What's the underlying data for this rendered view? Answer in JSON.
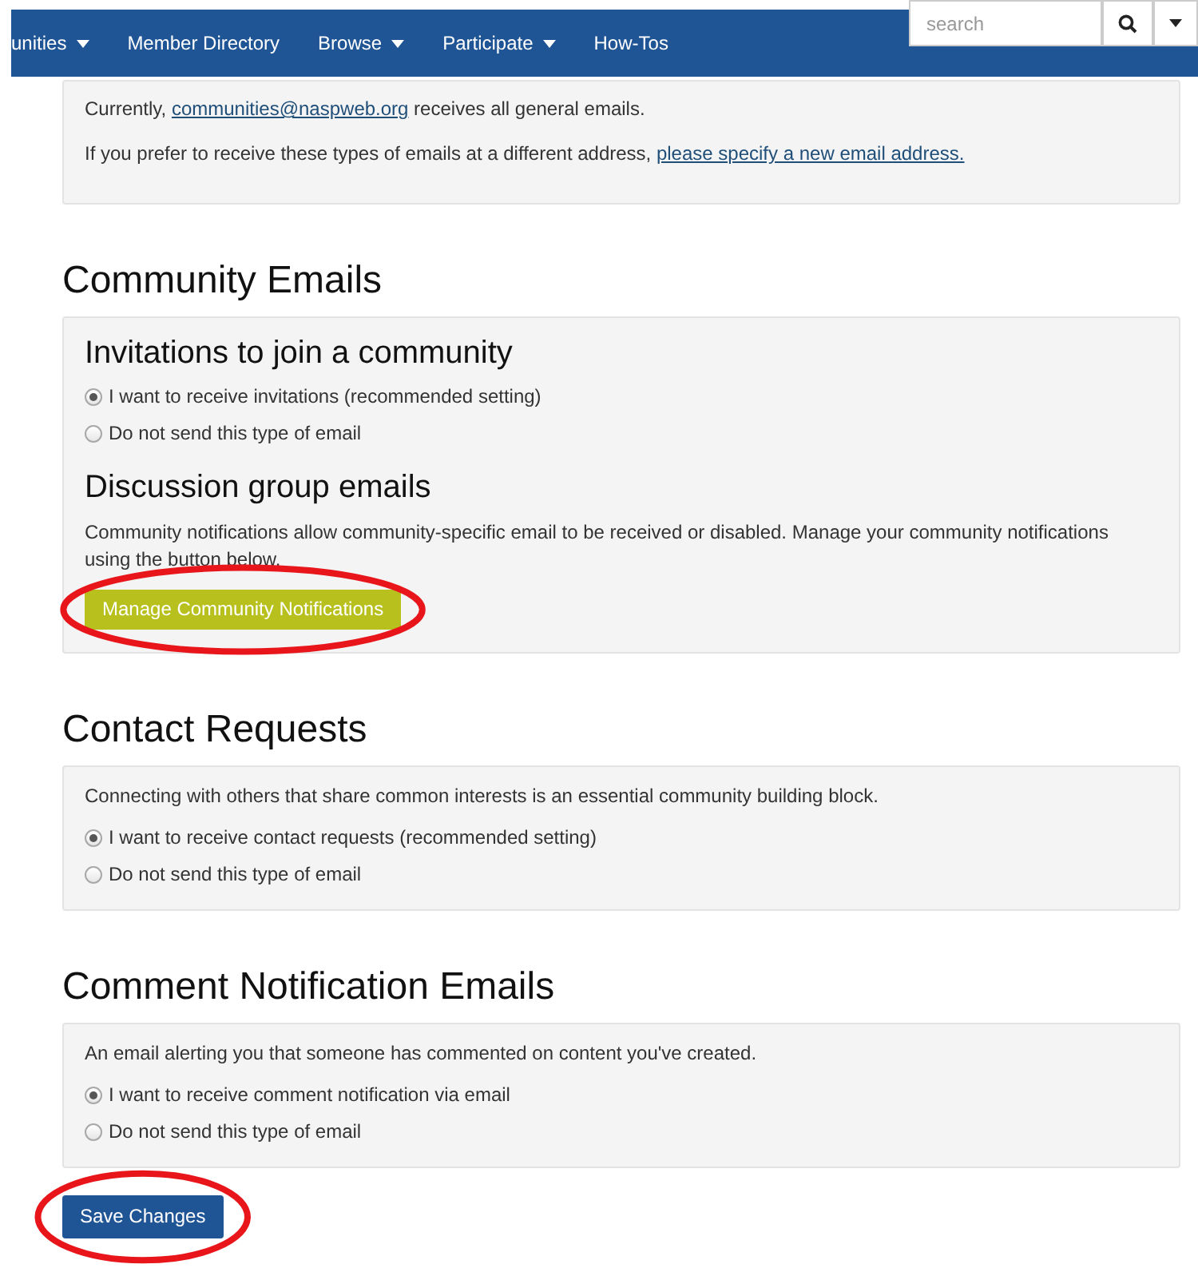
{
  "nav": {
    "items": [
      {
        "label": "unities",
        "dropdown": true
      },
      {
        "label": "Member Directory",
        "dropdown": false
      },
      {
        "label": "Browse",
        "dropdown": true
      },
      {
        "label": "Participate",
        "dropdown": true
      },
      {
        "label": "How-Tos",
        "dropdown": false
      }
    ],
    "search": {
      "placeholder": "search"
    }
  },
  "sections": [
    {
      "blocks": [
        {
          "kind": "linktext",
          "before": "Currently, ",
          "link": "communities@naspweb.org",
          "after": " receives all general emails."
        },
        {
          "kind": "linktext",
          "before": "If you prefer to receive these types of emails at a different address, ",
          "link": "please specify a new email address."
        }
      ]
    },
    {
      "title": "Community Emails",
      "blocks": [
        {
          "kind": "subheading",
          "text": "Invitations to join a community"
        },
        {
          "kind": "radio",
          "options": [
            {
              "label": "I want to receive invitations (recommended setting)",
              "selected": true
            },
            {
              "label": "Do not send this type of email",
              "selected": false
            }
          ]
        },
        {
          "kind": "subheading",
          "text": "Discussion group emails"
        },
        {
          "kind": "text",
          "text": "Community notifications allow community-specific email to be received or disabled. Manage your community notifications using the button below."
        },
        {
          "kind": "button",
          "label": "Manage Community Notifications",
          "circled": true
        }
      ]
    },
    {
      "title": "Contact Requests",
      "blocks": [
        {
          "kind": "text",
          "text": "Connecting with others that share common interests is an essential community building block."
        },
        {
          "kind": "radio",
          "options": [
            {
              "label": "I want to receive contact requests (recommended setting)",
              "selected": true
            },
            {
              "label": "Do not send this type of email",
              "selected": false
            }
          ]
        }
      ]
    },
    {
      "title": "Comment Notification Emails",
      "blocks": [
        {
          "kind": "text",
          "text": "An email alerting you that someone has commented on content you've created."
        },
        {
          "kind": "radio",
          "options": [
            {
              "label": "I want to receive comment notification via email",
              "selected": true
            },
            {
              "label": "Do not send this type of email",
              "selected": false
            }
          ]
        }
      ]
    }
  ],
  "save": {
    "label": "Save Changes",
    "circled": true
  }
}
